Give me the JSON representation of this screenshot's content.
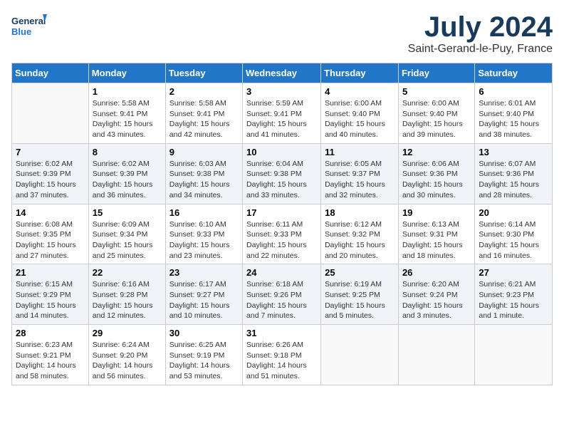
{
  "header": {
    "logo_line1": "General",
    "logo_line2": "Blue",
    "month": "July 2024",
    "location": "Saint-Gerand-le-Puy, France"
  },
  "columns": [
    "Sunday",
    "Monday",
    "Tuesday",
    "Wednesday",
    "Thursday",
    "Friday",
    "Saturday"
  ],
  "weeks": [
    [
      {
        "day": "",
        "info": ""
      },
      {
        "day": "1",
        "info": "Sunrise: 5:58 AM\nSunset: 9:41 PM\nDaylight: 15 hours\nand 43 minutes."
      },
      {
        "day": "2",
        "info": "Sunrise: 5:58 AM\nSunset: 9:41 PM\nDaylight: 15 hours\nand 42 minutes."
      },
      {
        "day": "3",
        "info": "Sunrise: 5:59 AM\nSunset: 9:41 PM\nDaylight: 15 hours\nand 41 minutes."
      },
      {
        "day": "4",
        "info": "Sunrise: 6:00 AM\nSunset: 9:40 PM\nDaylight: 15 hours\nand 40 minutes."
      },
      {
        "day": "5",
        "info": "Sunrise: 6:00 AM\nSunset: 9:40 PM\nDaylight: 15 hours\nand 39 minutes."
      },
      {
        "day": "6",
        "info": "Sunrise: 6:01 AM\nSunset: 9:40 PM\nDaylight: 15 hours\nand 38 minutes."
      }
    ],
    [
      {
        "day": "7",
        "info": "Sunrise: 6:02 AM\nSunset: 9:39 PM\nDaylight: 15 hours\nand 37 minutes."
      },
      {
        "day": "8",
        "info": "Sunrise: 6:02 AM\nSunset: 9:39 PM\nDaylight: 15 hours\nand 36 minutes."
      },
      {
        "day": "9",
        "info": "Sunrise: 6:03 AM\nSunset: 9:38 PM\nDaylight: 15 hours\nand 34 minutes."
      },
      {
        "day": "10",
        "info": "Sunrise: 6:04 AM\nSunset: 9:38 PM\nDaylight: 15 hours\nand 33 minutes."
      },
      {
        "day": "11",
        "info": "Sunrise: 6:05 AM\nSunset: 9:37 PM\nDaylight: 15 hours\nand 32 minutes."
      },
      {
        "day": "12",
        "info": "Sunrise: 6:06 AM\nSunset: 9:36 PM\nDaylight: 15 hours\nand 30 minutes."
      },
      {
        "day": "13",
        "info": "Sunrise: 6:07 AM\nSunset: 9:36 PM\nDaylight: 15 hours\nand 28 minutes."
      }
    ],
    [
      {
        "day": "14",
        "info": "Sunrise: 6:08 AM\nSunset: 9:35 PM\nDaylight: 15 hours\nand 27 minutes."
      },
      {
        "day": "15",
        "info": "Sunrise: 6:09 AM\nSunset: 9:34 PM\nDaylight: 15 hours\nand 25 minutes."
      },
      {
        "day": "16",
        "info": "Sunrise: 6:10 AM\nSunset: 9:33 PM\nDaylight: 15 hours\nand 23 minutes."
      },
      {
        "day": "17",
        "info": "Sunrise: 6:11 AM\nSunset: 9:33 PM\nDaylight: 15 hours\nand 22 minutes."
      },
      {
        "day": "18",
        "info": "Sunrise: 6:12 AM\nSunset: 9:32 PM\nDaylight: 15 hours\nand 20 minutes."
      },
      {
        "day": "19",
        "info": "Sunrise: 6:13 AM\nSunset: 9:31 PM\nDaylight: 15 hours\nand 18 minutes."
      },
      {
        "day": "20",
        "info": "Sunrise: 6:14 AM\nSunset: 9:30 PM\nDaylight: 15 hours\nand 16 minutes."
      }
    ],
    [
      {
        "day": "21",
        "info": "Sunrise: 6:15 AM\nSunset: 9:29 PM\nDaylight: 15 hours\nand 14 minutes."
      },
      {
        "day": "22",
        "info": "Sunrise: 6:16 AM\nSunset: 9:28 PM\nDaylight: 15 hours\nand 12 minutes."
      },
      {
        "day": "23",
        "info": "Sunrise: 6:17 AM\nSunset: 9:27 PM\nDaylight: 15 hours\nand 10 minutes."
      },
      {
        "day": "24",
        "info": "Sunrise: 6:18 AM\nSunset: 9:26 PM\nDaylight: 15 hours\nand 7 minutes."
      },
      {
        "day": "25",
        "info": "Sunrise: 6:19 AM\nSunset: 9:25 PM\nDaylight: 15 hours\nand 5 minutes."
      },
      {
        "day": "26",
        "info": "Sunrise: 6:20 AM\nSunset: 9:24 PM\nDaylight: 15 hours\nand 3 minutes."
      },
      {
        "day": "27",
        "info": "Sunrise: 6:21 AM\nSunset: 9:23 PM\nDaylight: 15 hours\nand 1 minute."
      }
    ],
    [
      {
        "day": "28",
        "info": "Sunrise: 6:23 AM\nSunset: 9:21 PM\nDaylight: 14 hours\nand 58 minutes."
      },
      {
        "day": "29",
        "info": "Sunrise: 6:24 AM\nSunset: 9:20 PM\nDaylight: 14 hours\nand 56 minutes."
      },
      {
        "day": "30",
        "info": "Sunrise: 6:25 AM\nSunset: 9:19 PM\nDaylight: 14 hours\nand 53 minutes."
      },
      {
        "day": "31",
        "info": "Sunrise: 6:26 AM\nSunset: 9:18 PM\nDaylight: 14 hours\nand 51 minutes."
      },
      {
        "day": "",
        "info": ""
      },
      {
        "day": "",
        "info": ""
      },
      {
        "day": "",
        "info": ""
      }
    ]
  ]
}
